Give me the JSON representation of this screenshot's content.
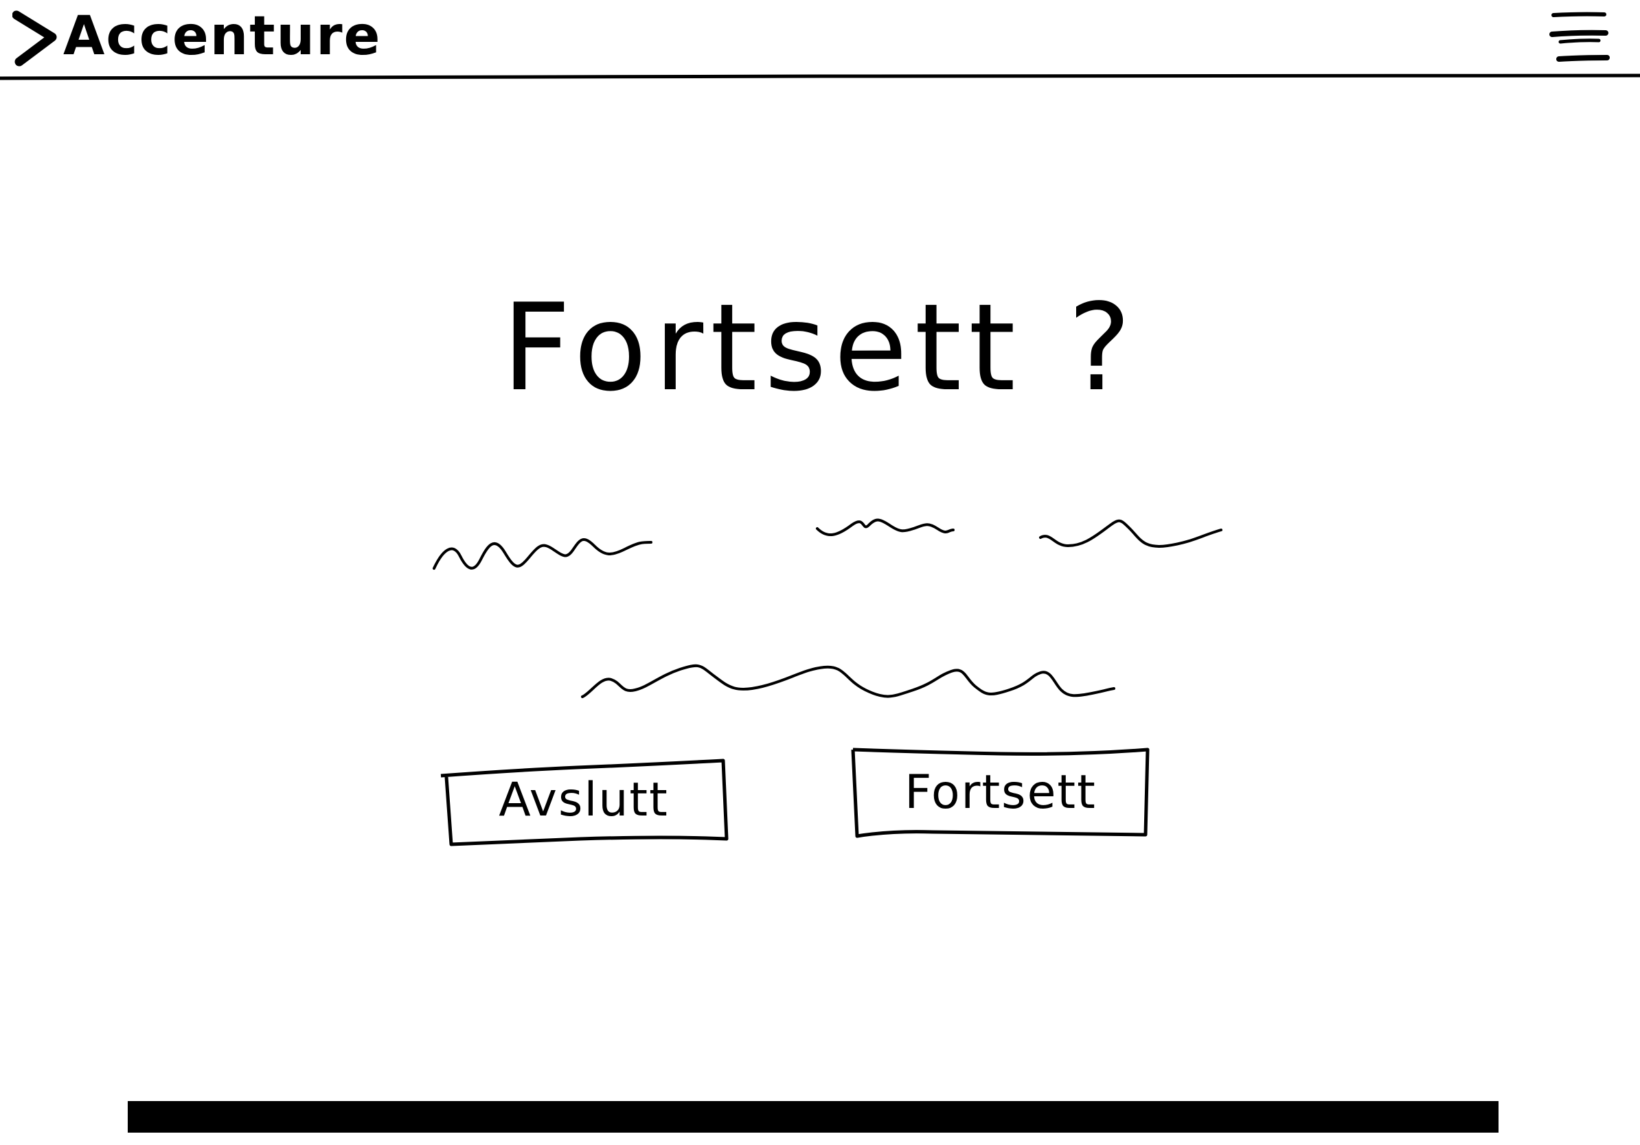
{
  "header": {
    "logo_text": "Accenture",
    "logo_icon": "chevron-right-icon",
    "menu_icon": "hamburger-menu-icon"
  },
  "main": {
    "title": "Fortsett ?",
    "placeholder_lines": 4
  },
  "buttons": {
    "cancel_label": "Avslutt",
    "continue_label": "Fortsett"
  },
  "progress": {
    "value": 1.0
  }
}
